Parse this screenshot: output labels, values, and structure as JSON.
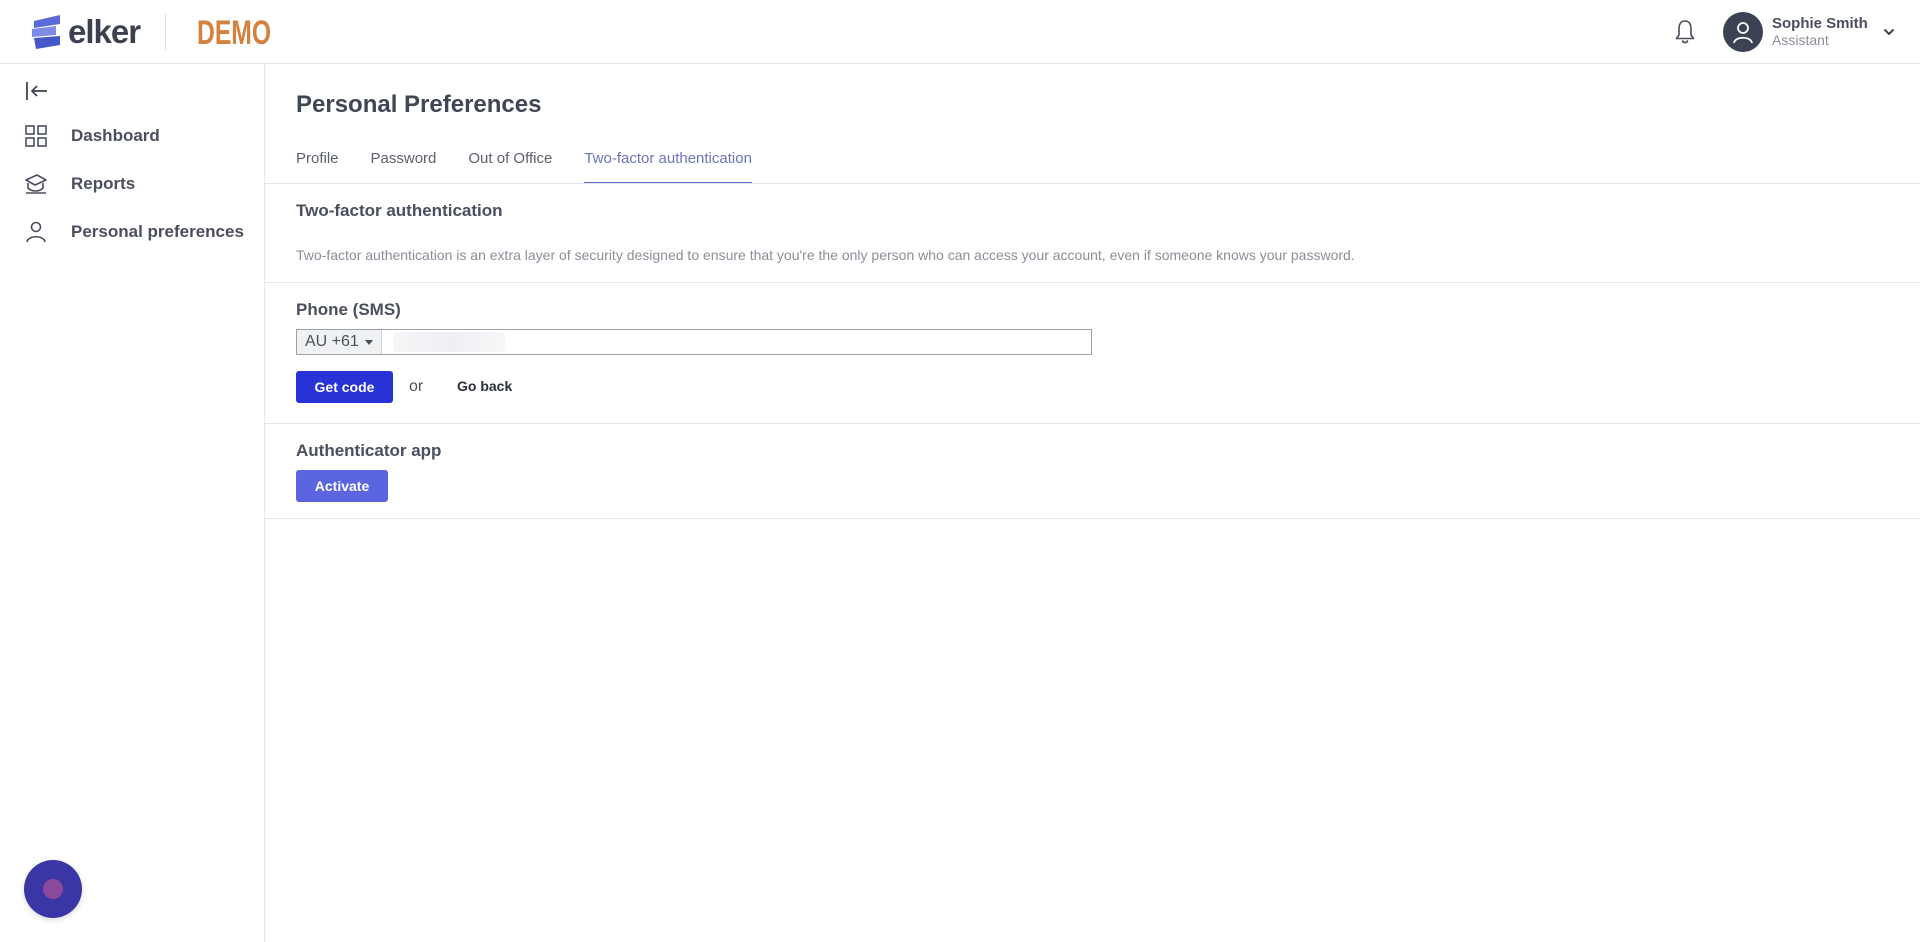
{
  "header": {
    "logo_text": "elker",
    "demo_label": "DEMO",
    "user": {
      "name": "Sophie Smith",
      "role": "Assistant"
    }
  },
  "sidebar": {
    "items": [
      {
        "label": "Dashboard",
        "icon": "grid-icon"
      },
      {
        "label": "Reports",
        "icon": "reports-icon"
      },
      {
        "label": "Personal preferences",
        "icon": "person-icon"
      }
    ]
  },
  "main": {
    "title": "Personal Preferences",
    "tabs": [
      {
        "label": "Profile",
        "active": false
      },
      {
        "label": "Password",
        "active": false
      },
      {
        "label": "Out of Office",
        "active": false
      },
      {
        "label": "Two-factor authentication",
        "active": true
      }
    ],
    "two_factor": {
      "title": "Two-factor authentication",
      "description": "Two-factor authentication is an extra layer of security designed to ensure that you're the only person who can access your account, even if someone knows your password."
    },
    "phone": {
      "title": "Phone (SMS)",
      "country_code": "AU +61",
      "value": "",
      "get_code_label": "Get code",
      "or_label": "or",
      "go_back_label": "Go back"
    },
    "authenticator": {
      "title": "Authenticator app",
      "activate_label": "Activate"
    }
  },
  "colors": {
    "primary": "#2733d6",
    "secondary_button": "#5a65df",
    "active_tab": "#6c74b8",
    "demo_orange": "#d4813e",
    "chat": "#3a36a6"
  }
}
